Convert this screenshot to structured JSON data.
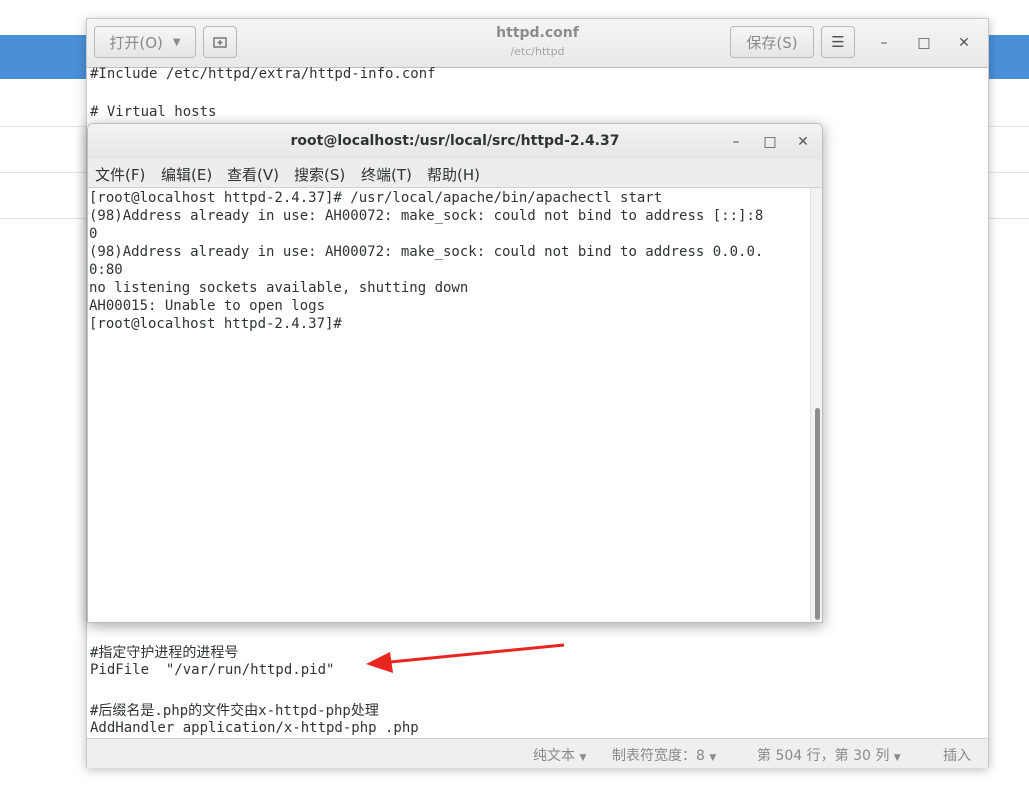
{
  "gedit": {
    "open_label": "打开(O)",
    "title": "httpd.conf",
    "subtitle": "/etc/httpd",
    "save_label": "保存(S)",
    "top_lines": [
      "#Include /etc/httpd/extra/httpd-info.conf",
      "",
      "# Virtual hosts"
    ],
    "bottom_lines": [
      "#指定守护进程的进程号",
      "PidFile  \"/var/run/httpd.pid\"",
      "",
      "#后缀名是.php的文件交由x-httpd-php处理",
      "AddHandler application/x-httpd-php .php"
    ],
    "status": {
      "mode": "纯文本",
      "tab_width": "制表符宽度：8",
      "position": "第 504 行，第 30 列",
      "insert": "插入"
    }
  },
  "terminal": {
    "title": "root@localhost:/usr/local/src/httpd-2.4.37",
    "menu": [
      "文件(F)",
      "编辑(E)",
      "查看(V)",
      "搜索(S)",
      "终端(T)",
      "帮助(H)"
    ],
    "lines": [
      "[root@localhost httpd-2.4.37]# /usr/local/apache/bin/apachectl start",
      "(98)Address already in use: AH00072: make_sock: could not bind to address [::]:8",
      "0",
      "(98)Address already in use: AH00072: make_sock: could not bind to address 0.0.0.",
      "0:80",
      "no listening sockets available, shutting down",
      "AH00015: Unable to open logs",
      "[root@localhost httpd-2.4.37]# "
    ]
  },
  "colors": {
    "background_header": "#4a90d9",
    "annotation_arrow": "#e8251f"
  }
}
